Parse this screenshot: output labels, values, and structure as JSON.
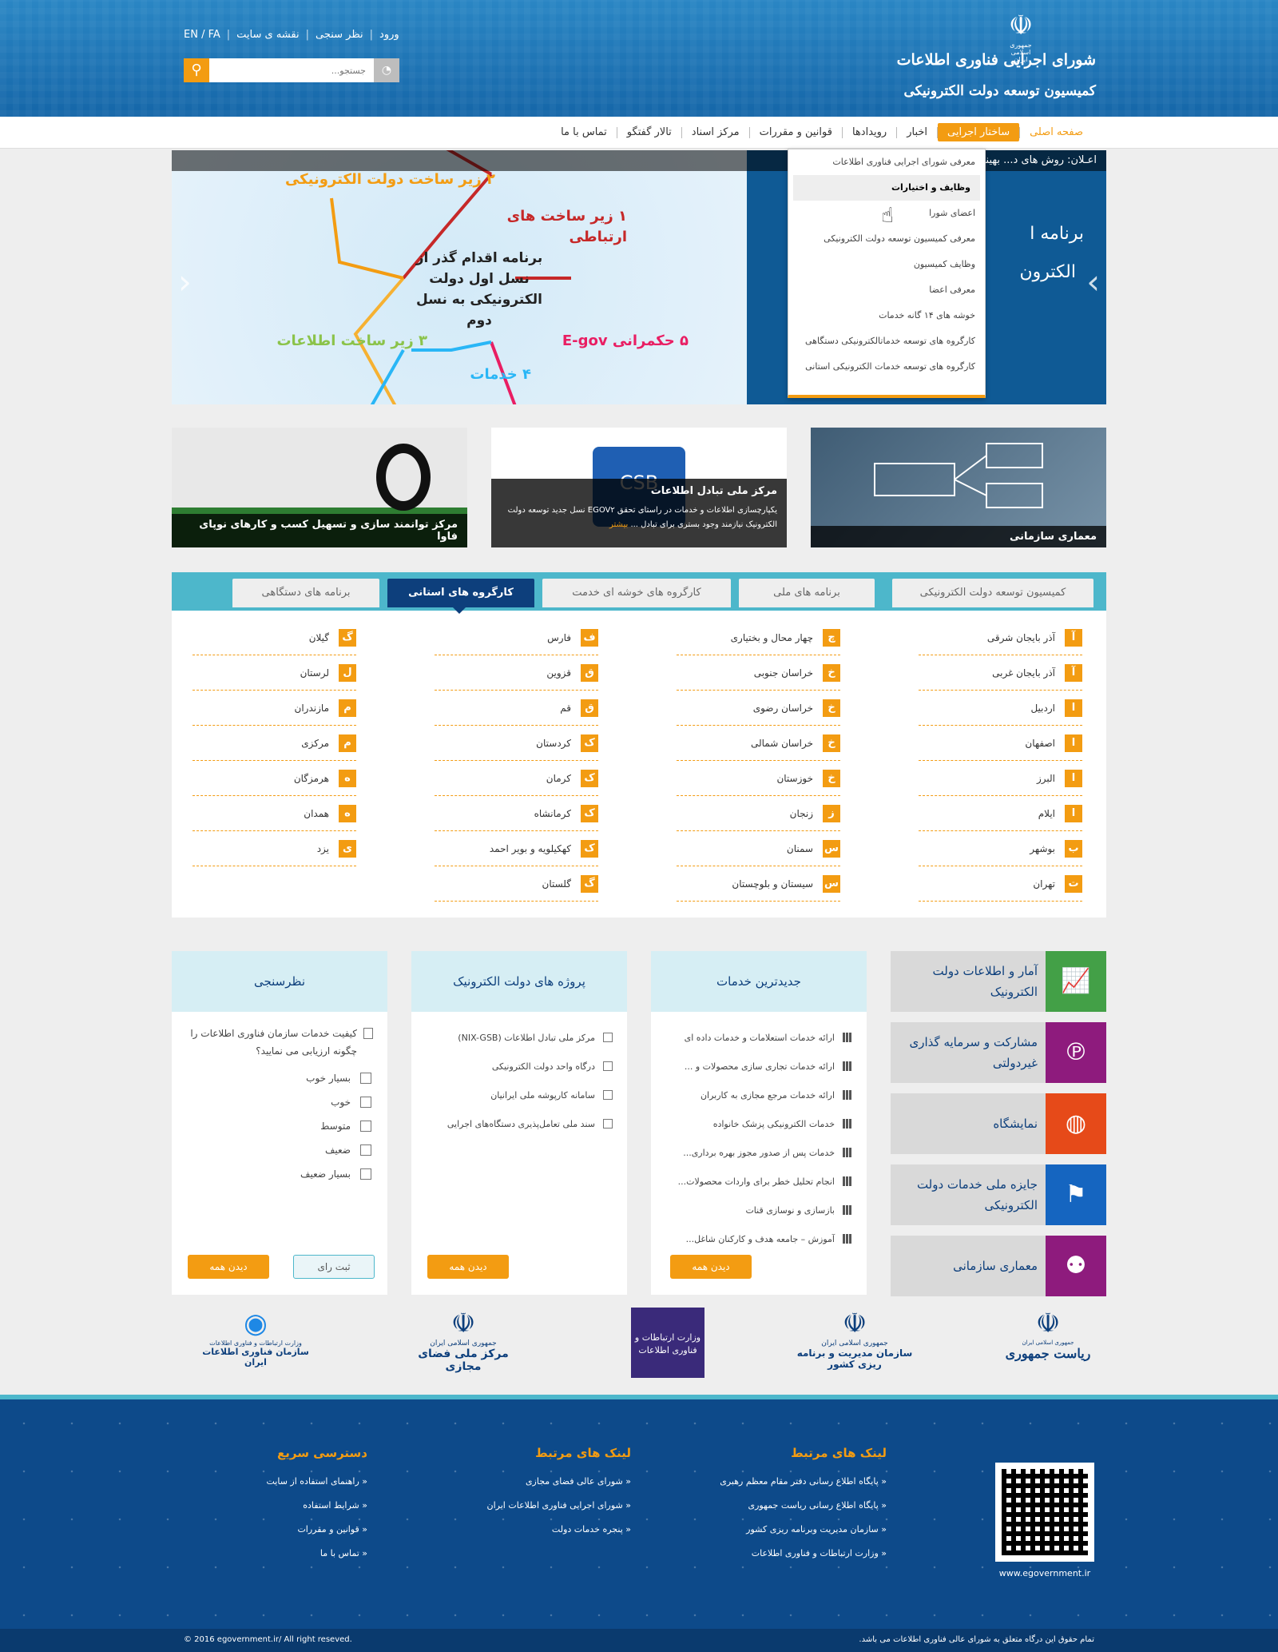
{
  "header": {
    "logo_small": "جمهوری اسلامی ایران",
    "logo_title": "شورای اجرایی فناوری اطلاعات",
    "logo_subtitle": "کمیسیون توسعه دولت الکترونیکی",
    "toplinks": [
      "ورود",
      "نظر سنجی",
      "نقشه ی سایت",
      "EN / FA"
    ],
    "search_placeholder": "جستجو..."
  },
  "nav": {
    "items": [
      "صفحه اصلی",
      "ساختار اجرایی",
      "اخبار",
      "رویدادها",
      "قوانین و مقررات",
      "مرکز اسناد",
      "تالار گفتگو",
      "تماس با ما"
    ]
  },
  "dropdown": {
    "items": [
      "معرفی شورای اجرایی فناوری اطلاعات",
      "وظایف و اختیارات",
      "اعضای شورا",
      "معرفی کمیسیون توسعه دولت الکترونیکی",
      "وظایف کمیسیون",
      "معرفی اعضا",
      "خوشه های ۱۴ گانه خدمات",
      "کارگروه های توسعه خدماتالکترونیکی دستگاهی",
      "کارگروه های توسعه خدمات الکترونیکی استانی"
    ]
  },
  "slider": {
    "ticker": "اعـلان: روش های د... بهینه از امکانات موجود مرکز فناوری اطلاعات",
    "right_title1": "برنامه ا",
    "right_title2": "الکترون",
    "center_text": "برنامه اقدام گذر از نسل اول دولت الکترونیکی به نسل دوم",
    "nodes": [
      "۱ زیر ساخت های ارتباطی",
      "۲ زیر ساخت دولت الکترونیکی",
      "۳ زیر ساخت اطلاعات",
      "۴ خدمات",
      "۵ حکمرانی E-gov"
    ]
  },
  "tiles": {
    "tile1": "معماری سازمانی",
    "tile2_title": "مرکز ملی تبادل اطلاعات",
    "tile2_desc": "یکپارچسازی اطلاعات و خدمات در راستای تحقق EGOV۲ نسل جدید توسعه دولت الکترونیک نیازمند وجود بستری برای تبادل ...",
    "tile2_more": "بیشتر",
    "tile2_box": "CSB",
    "tile3": "مرکز توانمند سازی و تسهیل کسب و کارهای نوپای فاوا"
  },
  "tabs": [
    "کمیسیون توسعه دولت الکترونیکی",
    "برنامه های ملی",
    "کارگروه های خوشه ای خدمت",
    "کارگروه های استانی",
    "برنامه های دستگاهی"
  ],
  "provinces": [
    [
      [
        "آ",
        "آذر بایجان شرقی"
      ],
      [
        "آ",
        "آذر بایجان غربی"
      ],
      [
        "ا",
        "اردبیل"
      ],
      [
        "ا",
        "اصفهان"
      ],
      [
        "ا",
        "البرز"
      ],
      [
        "ا",
        "ایلام"
      ],
      [
        "ب",
        "بوشهر"
      ],
      [
        "ت",
        "تهران"
      ]
    ],
    [
      [
        "چ",
        "چهار محال و بختیاری"
      ],
      [
        "خ",
        "خراسان جنوبی"
      ],
      [
        "خ",
        "خراسان رضوی"
      ],
      [
        "خ",
        "خراسان شمالی"
      ],
      [
        "خ",
        "خوزستان"
      ],
      [
        "ز",
        "زنجان"
      ],
      [
        "س",
        "سمنان"
      ],
      [
        "س",
        "سیستان و بلوچستان"
      ]
    ],
    [
      [
        "ف",
        "فارس"
      ],
      [
        "ق",
        "قزوین"
      ],
      [
        "ق",
        "قم"
      ],
      [
        "ک",
        "کردستان"
      ],
      [
        "ک",
        "کرمان"
      ],
      [
        "ک",
        "کرمانشاه"
      ],
      [
        "ک",
        "کهکیلویه و بویر احمد"
      ],
      [
        "گ",
        "گلستان"
      ]
    ],
    [
      [
        "گ",
        "گیلان"
      ],
      [
        "ل",
        "لرستان"
      ],
      [
        "م",
        "مازندران"
      ],
      [
        "م",
        "مرکزی"
      ],
      [
        "ه",
        "هرمزگان"
      ],
      [
        "ه",
        "همدان"
      ],
      [
        "ی",
        "یزد"
      ]
    ]
  ],
  "side_links": [
    "آمار و اطلاعات دولت الکترونیک",
    "مشارکت و سرمایه گذاری غیردولتی",
    "نمایشگاه",
    "جایزه ملی خدمات دولت الکترونیکی",
    "معماری سازمانی"
  ],
  "services": {
    "title": "جدیدترین خدمات",
    "items": [
      "ارائه خدمات استعلامات و خدمات داده ای",
      "ارائه خدمات تجاری سازی محصولات و ...",
      "ارائه خدمات مرجع مجازی به کاربران",
      "خدمات الکترونیکی پزشک خانواده",
      "خدمات پس از صدور مجوز بهره برداری...",
      "انجام تحلیل خطر برای واردات محصولات...",
      "بازسازی و نوسازی قنات",
      "آموزش – جامعه هدف و کارکنان شاغل..."
    ],
    "button": "دیدن همه"
  },
  "projects": {
    "title": "پروژه های دولت الکترونیک",
    "items": [
      "مرکز ملی تبادل اطلاعات (NIX-GSB)",
      "درگاه واحد دولت الکترونیکی",
      "سامانه کارپوشه ملی ایرانیان",
      "سند ملی تعامل‌پذیری دستگاه‌های  اجرایی"
    ],
    "button": "دیدن همه"
  },
  "poll": {
    "title": "نظرسنجی",
    "question": "کیفیت خدمات سازمان فناوری اطلاعات را چگونه ارزیابی می نمایید؟",
    "options": [
      "بسیار خوب",
      "خوب",
      "متوسط",
      "ضعیف",
      "بسیار ضعیف"
    ],
    "submit": "ثبت رای",
    "view_all": "دیدن همه"
  },
  "logos": {
    "l1_a": "ریاست جمهوری",
    "l1_b": "جمهوری اسلامی ایران",
    "l2_a": "سازمان مدیریت و برنامه ریزی کشور",
    "l2_b": "جمهوری اسلامی ایران",
    "l3": "وزارت ارتباطات و فناوری اطلاعات",
    "l4_a": "مرکز ملی فضای مجازی",
    "l4_b": "جمهوری اسلامی ایران",
    "l5_a": "سازمان فناوری اطلاعات ایران",
    "l5_b": "وزارت ارتباطات و فناوری اطلاعات"
  },
  "footer": {
    "col1_title": "لینک های مرتبط",
    "col1": [
      "پایگاه اطلاع رسانی دفتر مقام معظم رهبری",
      "پایگاه اطلاع رسانی ریاست جمهوری",
      "سازمان مدیریت وبرنامه ریزی کشور",
      "وزارت ارتباطات و فناوری اطلاعات"
    ],
    "col2_title": "لینک های مرتبط",
    "col2": [
      "شورای عالی فضای مجازی",
      "شورای اجرایی فناوری اطلاعات ایران",
      "پنجره خدمات دولت"
    ],
    "col3_title": "دسترسی سریع",
    "col3": [
      "راهنمای استفاده از سایت",
      "شرایط استفاده",
      "قوانین و مقررات",
      "تماس با ما"
    ],
    "qr_url": "www.egovernment.ir",
    "copyright_fa": "تمام حقوق این درگاه متعلق به شورای عالی فناوری اطلاعات می باشد.",
    "copyright_en": "© 2016 egovernment.ir/ All right reseved."
  }
}
